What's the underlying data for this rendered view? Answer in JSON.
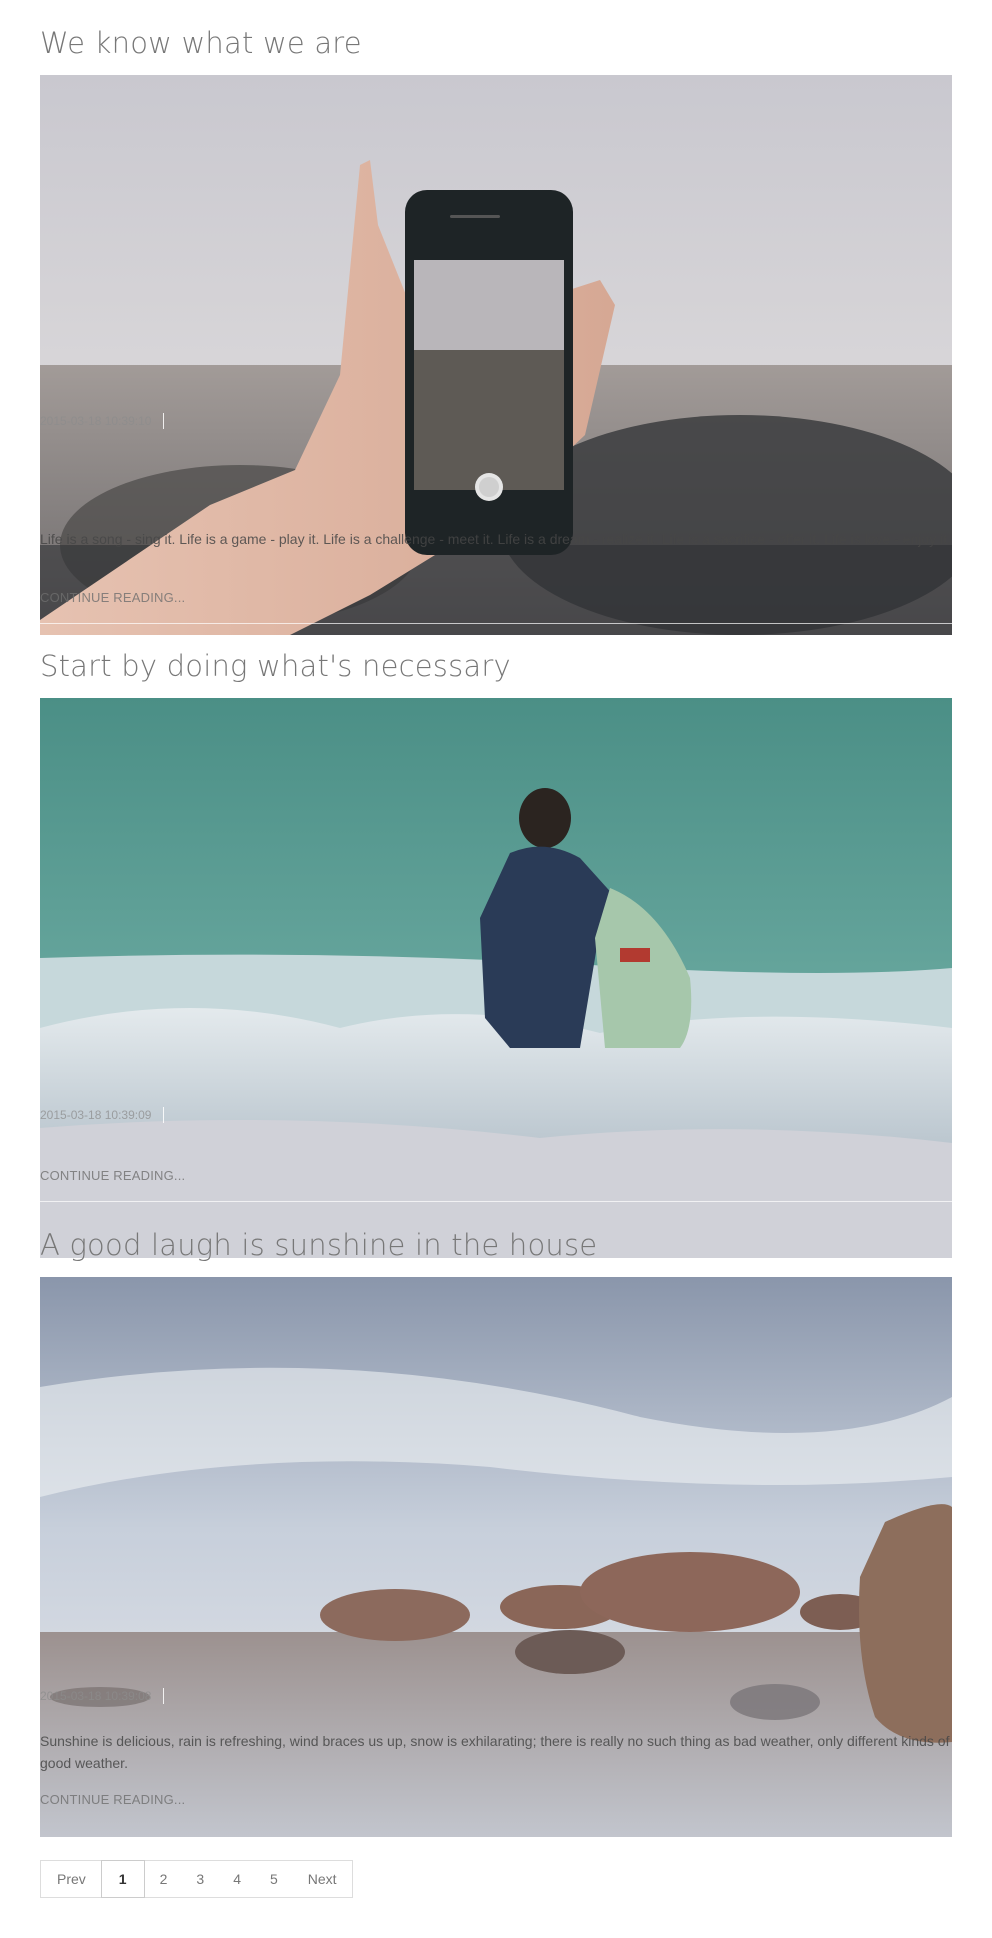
{
  "posts": [
    {
      "title": "We know what we are",
      "image": "hand-holding-phone-photo",
      "date": "2015-03-18 10:39:10",
      "excerpt": "Life is a song - sing it. Life is a game - play it. Life is a challenge - meet it. Life is a dream - realize it. Life is a sacrifice - offer it. Life is love - enjoy it.",
      "continue": "CONTINUE READING..."
    },
    {
      "title": "Start by doing what's necessary",
      "image": "surfer-in-waves-photo",
      "date": "2015-03-18 10:39:09",
      "excerpt": "",
      "continue": "CONTINUE READING..."
    },
    {
      "title": "A good laugh is sunshine in the house",
      "image": "rocky-beach-photo",
      "date": "2015-03-18 10:39:08",
      "excerpt": "Sunshine is delicious, rain is refreshing, wind braces us up, snow is exhilarating; there is really no such thing as bad weather, only different kinds of good weather.",
      "continue": "CONTINUE READING..."
    }
  ],
  "pagination": {
    "prev": "Prev",
    "pages": [
      "1",
      "2",
      "3",
      "4",
      "5"
    ],
    "active": "1",
    "next": "Next"
  },
  "colors": {
    "title": "#777777",
    "text": "#555555",
    "border": "#dddddd"
  }
}
